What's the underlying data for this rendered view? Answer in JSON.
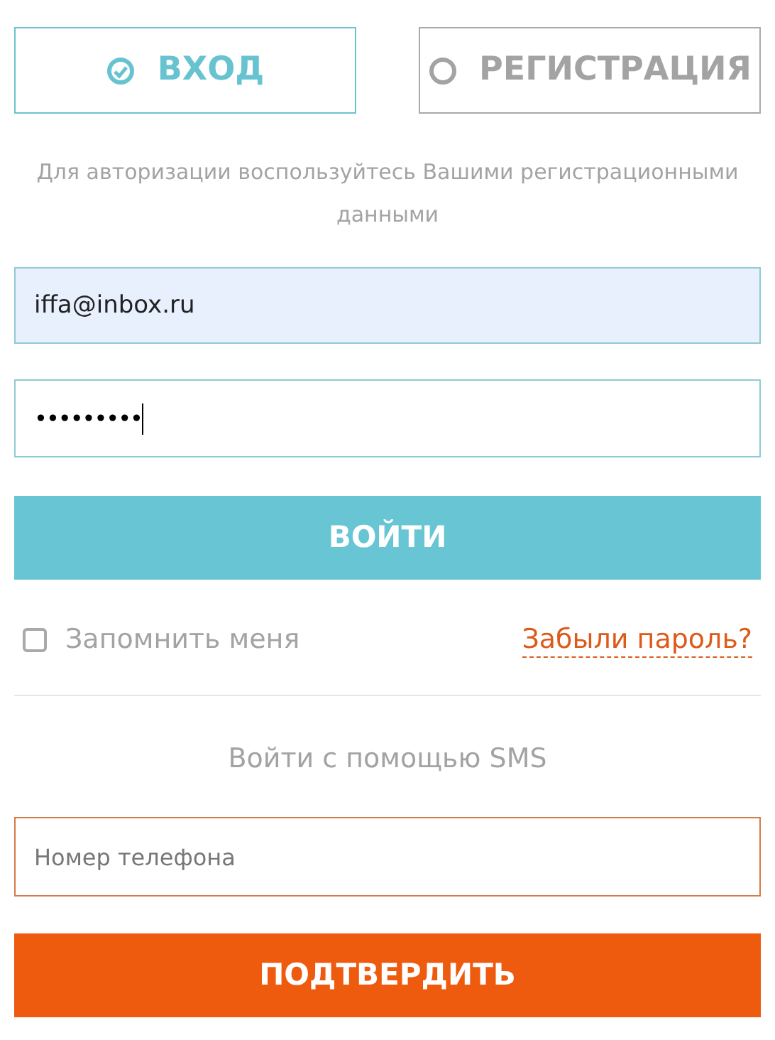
{
  "tabs": [
    {
      "label": "ВХОД",
      "selected": true
    },
    {
      "label": "РЕГИСТРАЦИЯ",
      "selected": false
    }
  ],
  "hint": "Для авторизации воспользуйтесь Вашими регистрационными данными",
  "email": {
    "value": "iffa@inbox.ru"
  },
  "password": {
    "value": "•••••••••"
  },
  "login_button": "ВОЙТИ",
  "remember": {
    "label": "Запомнить меня",
    "checked": false
  },
  "forgot_link": "Забыли пароль?",
  "sms_heading": "Войти с помощью SMS",
  "phone": {
    "placeholder": "Номер телефона"
  },
  "confirm_button": "ПОДТВЕРДИТЬ"
}
